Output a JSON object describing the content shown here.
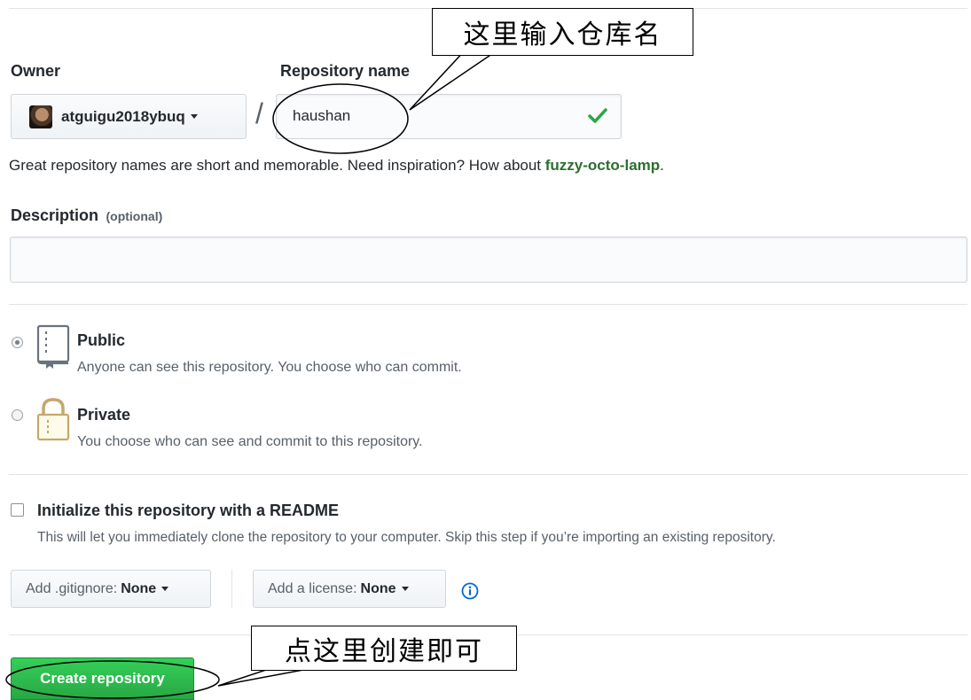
{
  "owner": {
    "label": "Owner",
    "username": "atguigu2018ybuq"
  },
  "separator": "/",
  "repository_name": {
    "label": "Repository name",
    "value": "haushan"
  },
  "name_hint": {
    "prefix": "Great repository names are short and memorable. Need inspiration? How about ",
    "suggestion": "fuzzy-octo-lamp",
    "suffix": "."
  },
  "description": {
    "label": "Description",
    "optional": "(optional)",
    "value": ""
  },
  "visibility": {
    "public": {
      "title": "Public",
      "desc": "Anyone can see this repository. You choose who can commit."
    },
    "private": {
      "title": "Private",
      "desc": "You choose who can see and commit to this repository."
    }
  },
  "readme": {
    "label": "Initialize this repository with a README",
    "desc": "This will let you immediately clone the repository to your computer. Skip this step if you’re importing an existing repository."
  },
  "gitignore": {
    "label": "Add .gitignore:",
    "value": "None"
  },
  "license": {
    "label": "Add a license:",
    "value": "None"
  },
  "create_button": "Create repository",
  "annotations": {
    "repo_name_callout": "这里输入仓库名",
    "create_callout": "点这里创建即可"
  },
  "colors": {
    "green": "#28a745",
    "link_green": "#2c6e2f",
    "blue_info": "#0366d6",
    "border": "#e1e4e8"
  }
}
